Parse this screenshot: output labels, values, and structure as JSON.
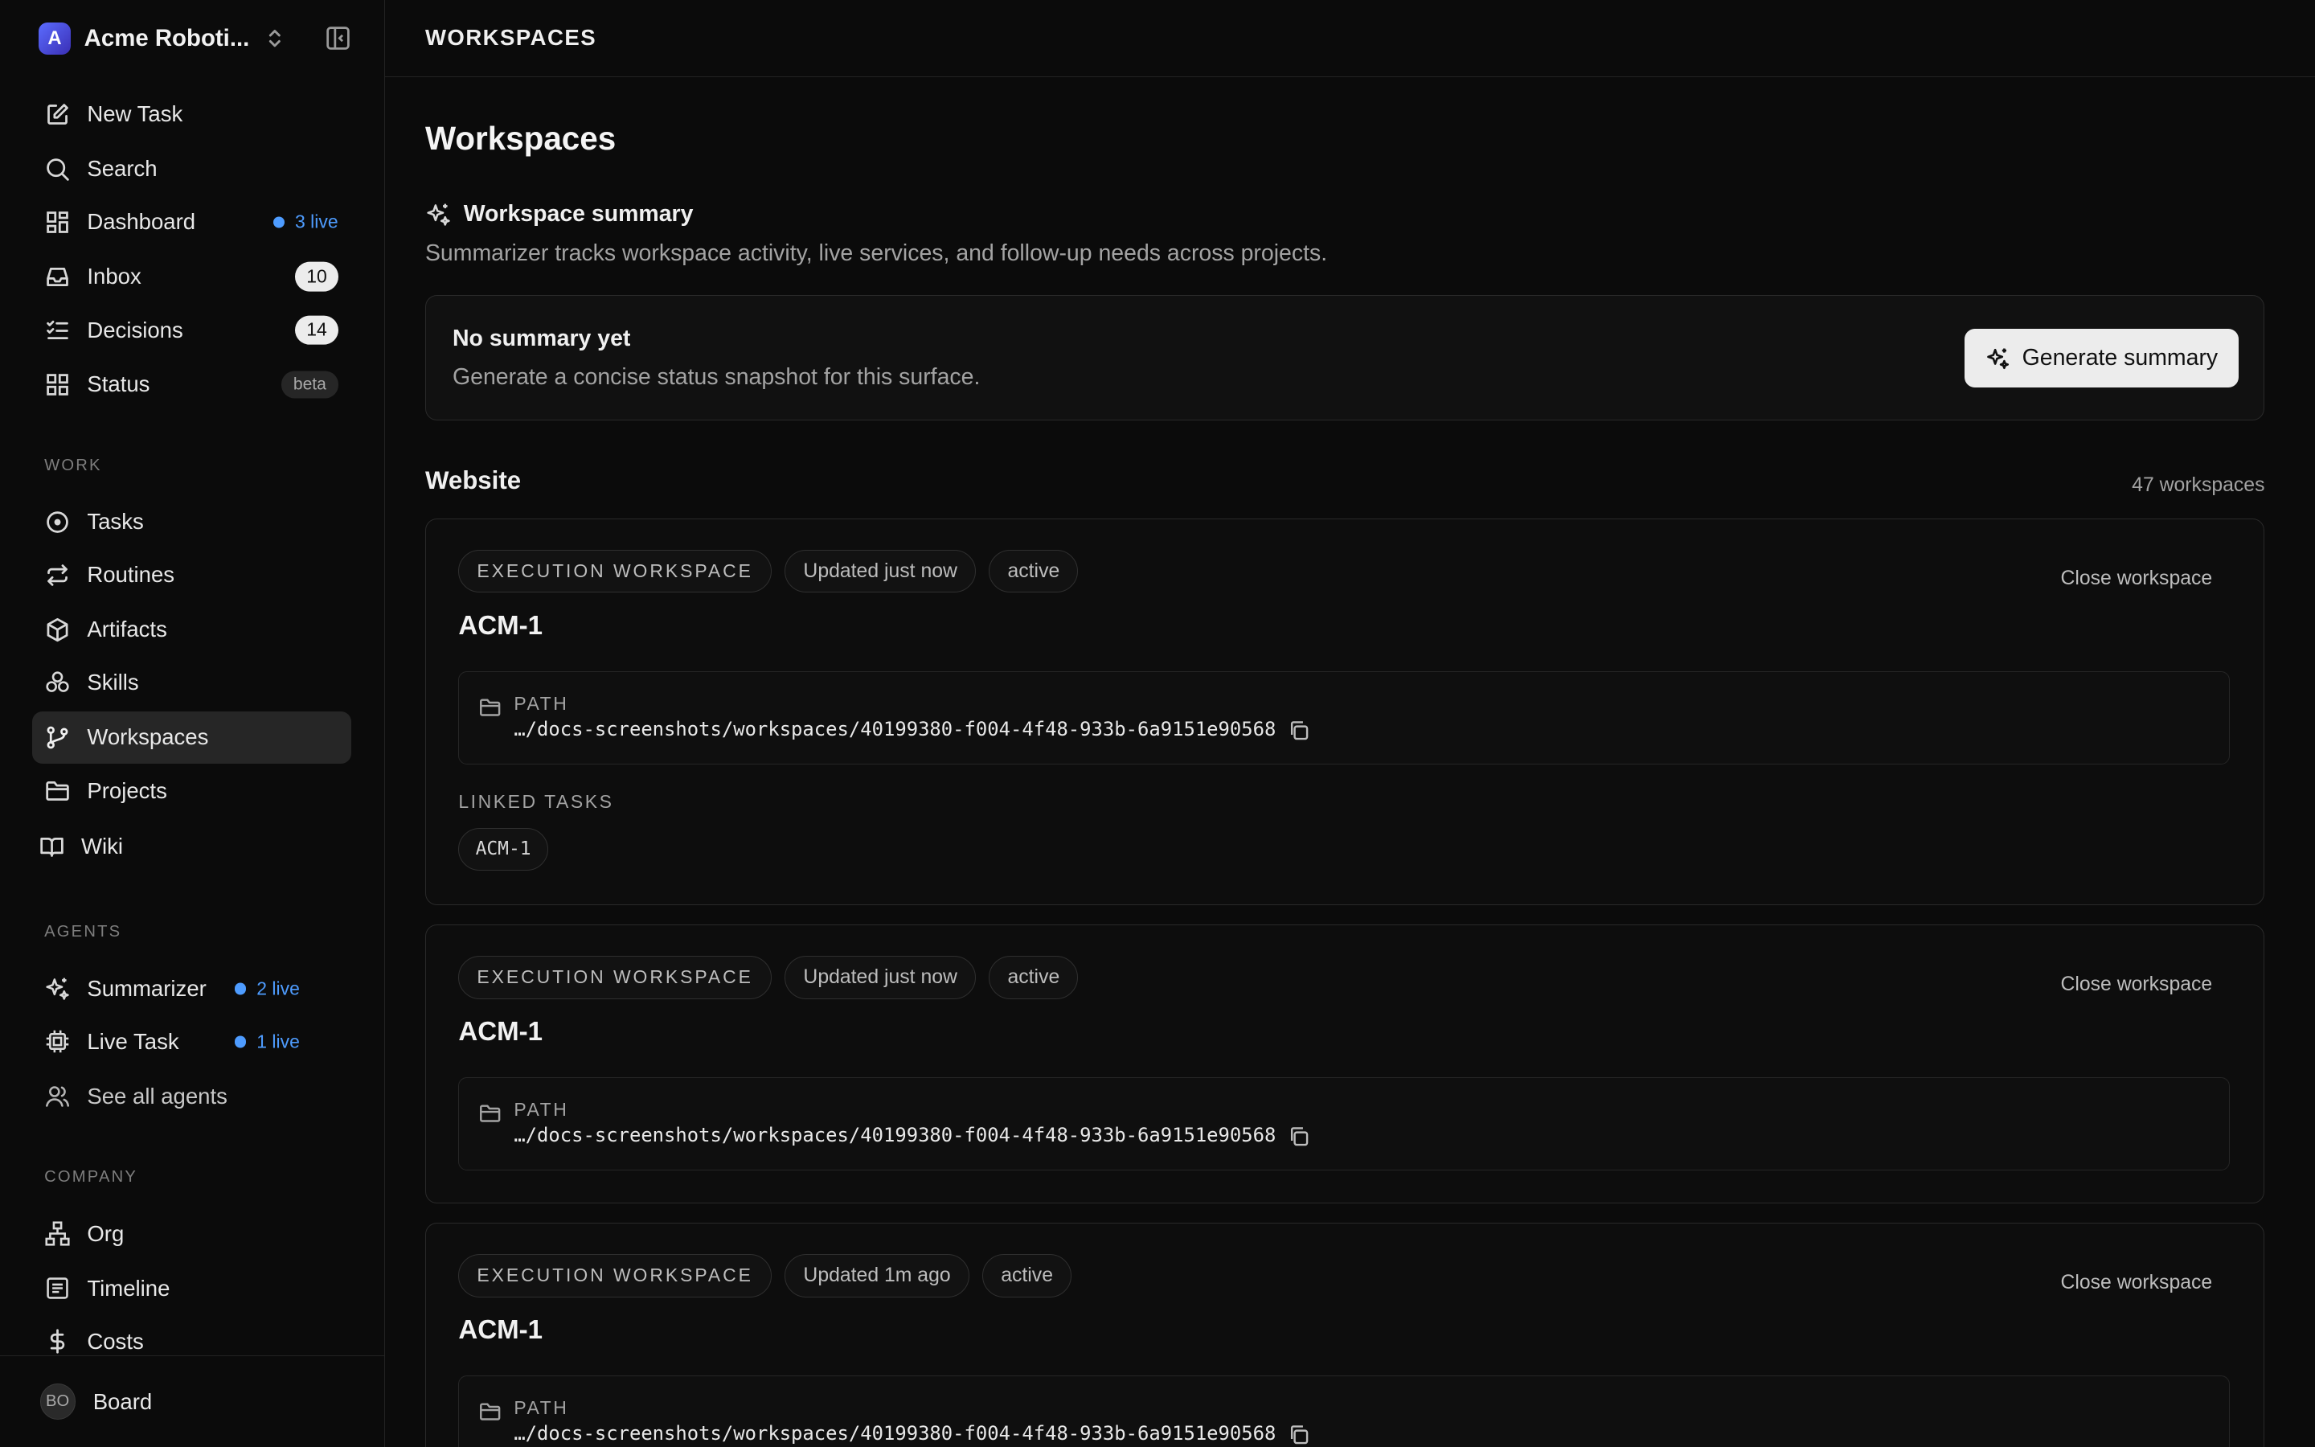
{
  "org": {
    "initial": "A",
    "name": "Acme Roboti..."
  },
  "nav": {
    "new_task": "New Task",
    "search": "Search",
    "dashboard": "Dashboard",
    "dashboard_live": "3 live",
    "inbox": "Inbox",
    "inbox_count": "10",
    "decisions": "Decisions",
    "decisions_count": "14",
    "status": "Status",
    "status_badge": "beta"
  },
  "sections": {
    "work": "WORK",
    "agents": "AGENTS",
    "company": "COMPANY"
  },
  "work": {
    "tasks": "Tasks",
    "routines": "Routines",
    "artifacts": "Artifacts",
    "skills": "Skills",
    "workspaces": "Workspaces",
    "projects": "Projects",
    "wiki": "Wiki"
  },
  "agents": {
    "summarizer": "Summarizer",
    "summarizer_live": "2 live",
    "live_task": "Live Task",
    "live_task_live": "1 live",
    "see_all": "See all agents"
  },
  "company": {
    "org": "Org",
    "timeline": "Timeline",
    "costs": "Costs"
  },
  "user": {
    "initials": "BO",
    "name": "Board"
  },
  "topbar": {
    "title": "WORKSPACES"
  },
  "page": {
    "title": "Workspaces",
    "summary_title": "Workspace summary",
    "summary_desc": "Summarizer tracks workspace activity, live services, and follow-up needs across projects.",
    "summary_box_title": "No summary yet",
    "summary_box_desc": "Generate a concise status snapshot for this surface.",
    "generate_label": "Generate summary",
    "group_title": "Website",
    "group_count": "47 workspaces"
  },
  "cards": [
    {
      "type": "EXECUTION WORKSPACE",
      "updated": "Updated just now",
      "state": "active",
      "close": "Close workspace",
      "title": "ACM-1",
      "path_label": "PATH",
      "path": "…/docs-screenshots/workspaces/40199380-f004-4f48-933b-6a9151e90568",
      "linked_label": "LINKED TASKS",
      "linked": "ACM-1"
    },
    {
      "type": "EXECUTION WORKSPACE",
      "updated": "Updated just now",
      "state": "active",
      "close": "Close workspace",
      "title": "ACM-1",
      "path_label": "PATH",
      "path": "…/docs-screenshots/workspaces/40199380-f004-4f48-933b-6a9151e90568"
    },
    {
      "type": "EXECUTION WORKSPACE",
      "updated": "Updated 1m ago",
      "state": "active",
      "close": "Close workspace",
      "title": "ACM-1",
      "path_label": "PATH",
      "path": "…/docs-screenshots/workspaces/40199380-f004-4f48-933b-6a9151e90568"
    }
  ]
}
